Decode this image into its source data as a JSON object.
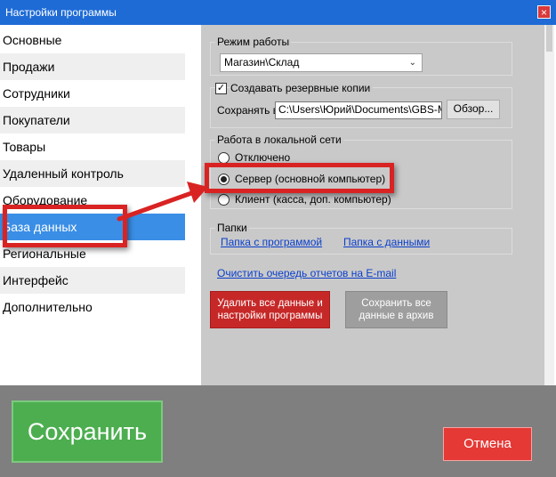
{
  "window": {
    "title": "Настройки программы",
    "close_glyph": "×"
  },
  "sidebar": {
    "items": [
      {
        "label": "Основные"
      },
      {
        "label": "Продажи"
      },
      {
        "label": "Сотрудники"
      },
      {
        "label": "Покупатели"
      },
      {
        "label": "Товары"
      },
      {
        "label": "Удаленный контроль"
      },
      {
        "label": "Оборудование"
      },
      {
        "label": "База данных",
        "active": true
      },
      {
        "label": "Региональные"
      },
      {
        "label": "Интерфейс"
      },
      {
        "label": "Дополнительно"
      }
    ]
  },
  "work_mode": {
    "group_label": "Режим работы",
    "selected": "Магазин\\Склад"
  },
  "backup": {
    "checkbox_label": "Создавать резервные копии",
    "checked": true,
    "save_in_label": "Сохранять в",
    "path": "C:\\Users\\Юрий\\Documents\\GBS-Mar",
    "browse_label": "Обзор..."
  },
  "network": {
    "group_label": "Работа в локальной сети",
    "options": [
      {
        "label": "Отключено",
        "selected": false
      },
      {
        "label": "Сервер (основной компьютер)",
        "selected": true
      },
      {
        "label": "Клиент (касса, доп. компьютер)",
        "selected": false
      }
    ]
  },
  "folders": {
    "group_label": "Папки",
    "program_link": "Папка с программой",
    "data_link": "Папка с данными"
  },
  "clear_queue_link": "Очистить очередь отчетов на E-mail",
  "actions": {
    "delete_line1": "Удалить все данные и",
    "delete_line2": "настройки программы",
    "archive_line1": "Сохранить все",
    "archive_line2": "данные в архив"
  },
  "footer": {
    "save_label": "Сохранить",
    "cancel_label": "Отмена"
  },
  "colors": {
    "titlebar": "#1e6bd6",
    "active_item": "#3a8ee6",
    "save": "#4cae4f",
    "cancel": "#e53935",
    "highlight": "#d92323"
  }
}
